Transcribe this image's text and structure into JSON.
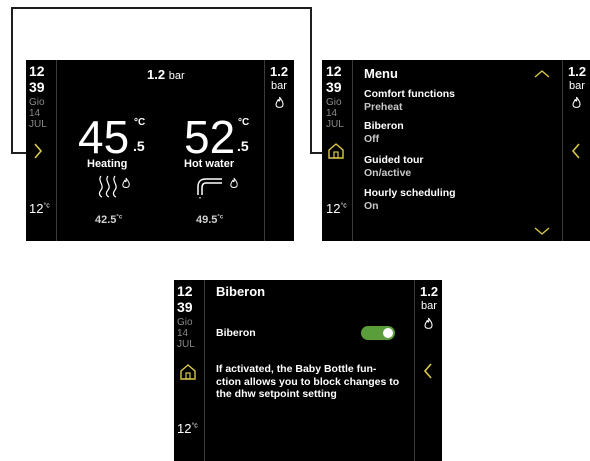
{
  "colors": {
    "screen_bg": "#000000",
    "accent_yellow": "#d9c84a",
    "toggle_on": "#5a9e3c",
    "muted_text": "#8a8a8a"
  },
  "screen_home": {
    "clock": {
      "hour": "12",
      "minute": "39",
      "day": "Gio",
      "date": "14",
      "month": "JUL"
    },
    "outside_temp": "12",
    "outside_unit": "°c",
    "header_pressure_value": "1.2",
    "header_pressure_unit": "bar",
    "side_pressure_value": "1.2",
    "side_pressure_unit": "bar",
    "heating": {
      "temp_int": "45",
      "temp_dec": ".5",
      "unit": "°C",
      "label": "Heating",
      "setpoint": "42.5",
      "setpoint_unit": "°c"
    },
    "hot_water": {
      "temp_int": "52",
      "temp_dec": ".5",
      "unit": "°C",
      "label": "Hot water",
      "setpoint": "49.5",
      "setpoint_unit": "°c"
    },
    "icons": [
      "chevron-right-icon",
      "radiator-heat-icon",
      "flame-icon",
      "tap-icon",
      "flame-icon"
    ]
  },
  "screen_menu": {
    "clock": {
      "hour": "12",
      "minute": "39",
      "day": "Gio",
      "date": "14",
      "month": "JUL"
    },
    "outside_temp": "12",
    "outside_unit": "°c",
    "title": "Menu",
    "pressure_value": "1.2",
    "pressure_unit": "bar",
    "items": [
      {
        "label": "Comfort functions",
        "value": "Preheat"
      },
      {
        "label": "Biberon",
        "value": "Off"
      },
      {
        "label": "Guided tour",
        "value": "On/active"
      },
      {
        "label": "Hourly scheduling",
        "value": "On"
      }
    ],
    "icons": [
      "home-icon",
      "chevron-up-icon",
      "chevron-down-icon",
      "chevron-left-icon",
      "flame-icon"
    ]
  },
  "screen_biberon": {
    "clock": {
      "hour": "12",
      "minute": "39",
      "day": "Gio",
      "date": "14",
      "month": "JUL"
    },
    "outside_temp": "12",
    "outside_unit": "°c",
    "title": "Biberon",
    "pressure_value": "1.2",
    "pressure_unit": "bar",
    "toggle_label": "Biberon",
    "toggle_state": "on",
    "description_lines": [
      "If activated, the Baby Bottle fun-",
      "ction allows you to block changes to",
      "the dhw setpoint setting"
    ],
    "icons": [
      "home-icon",
      "chevron-left-icon",
      "flame-icon"
    ]
  }
}
